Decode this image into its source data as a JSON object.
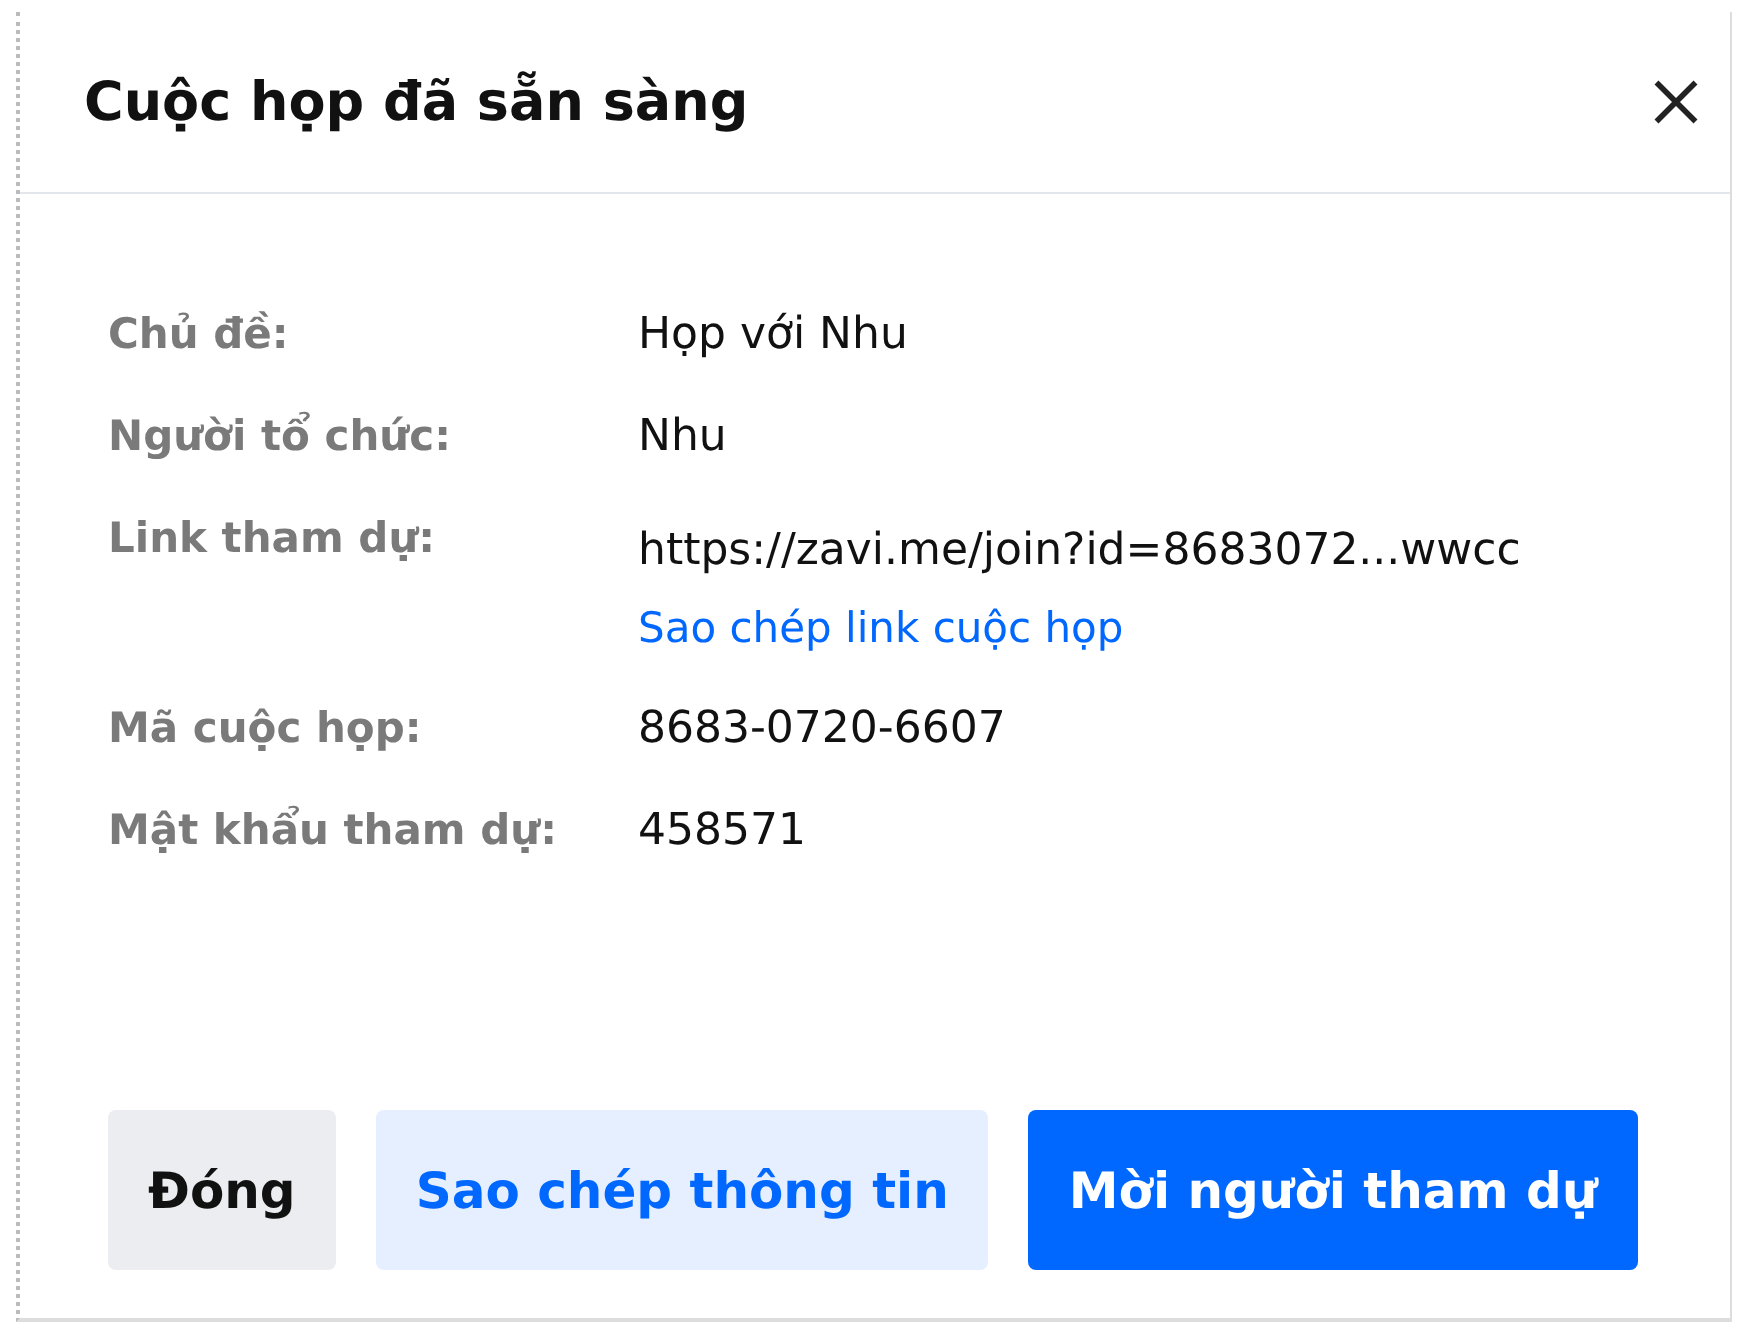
{
  "dialog": {
    "title": "Cuộc họp đã sẵn sàng"
  },
  "fields": [
    {
      "label": "Chủ đề:",
      "value": "Họp với Nhu"
    },
    {
      "label": "Người tổ chức:",
      "value": "Nhu"
    },
    {
      "label": "Link tham dự:",
      "value": "https://zavi.me/join?id=8683072...wwcc",
      "link": "Sao chép link cuộc họp"
    },
    {
      "label": "Mã cuộc họp:",
      "value": "8683-0720-6607"
    },
    {
      "label": "Mật khẩu tham dự:",
      "value": "458571"
    }
  ],
  "buttons": [
    {
      "label": "Đóng",
      "kind": "neutral"
    },
    {
      "label": "Sao chép thông tin",
      "kind": "secondary"
    },
    {
      "label": "Mời người tham dự",
      "kind": "primary"
    }
  ]
}
